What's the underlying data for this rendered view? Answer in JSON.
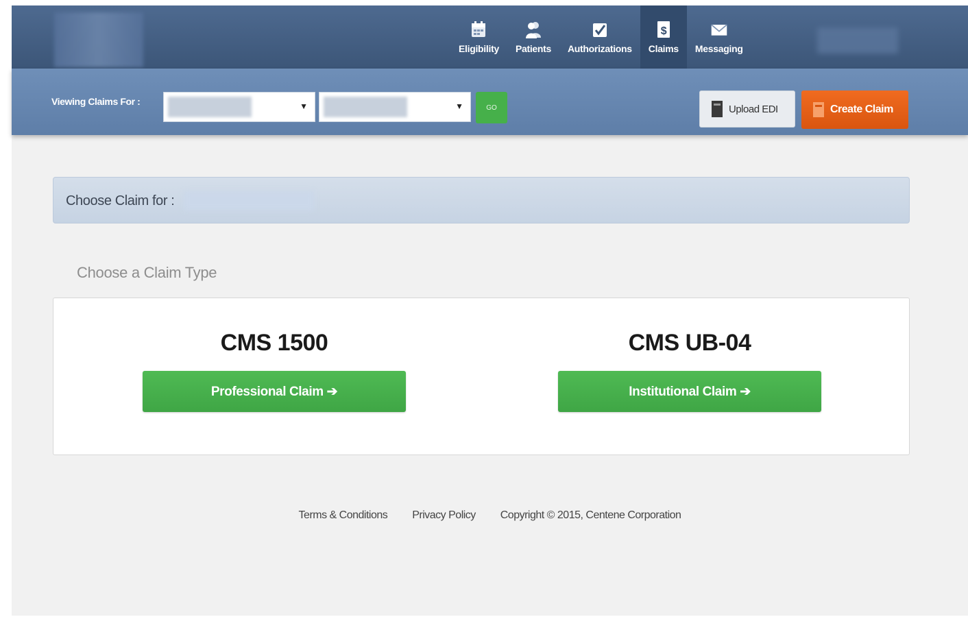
{
  "nav": {
    "items": [
      {
        "label": "Eligibility",
        "icon": "calendar-icon"
      },
      {
        "label": "Patients",
        "icon": "users-icon"
      },
      {
        "label": "Authorizations",
        "icon": "checkbox-icon"
      },
      {
        "label": "Claims",
        "icon": "dollar-document-icon",
        "active": true
      },
      {
        "label": "Messaging",
        "icon": "envelope-icon"
      }
    ]
  },
  "toolbar": {
    "viewing_label": "Viewing Claims For :",
    "go_label": "GO",
    "upload_label": "Upload EDI",
    "create_label": "Create Claim"
  },
  "choose_panel": {
    "label": "Choose Claim for :"
  },
  "claim_type": {
    "heading": "Choose a Claim Type",
    "options": [
      {
        "title": "CMS 1500",
        "button": "Professional Claim ➔"
      },
      {
        "title": "CMS UB-04",
        "button": "Institutional Claim ➔"
      }
    ]
  },
  "footer": {
    "terms": "Terms & Conditions",
    "privacy": "Privacy Policy",
    "copyright": "Copyright © 2015, Centene Corporation"
  },
  "colors": {
    "topbar": "#44608a",
    "subbar": "#6888b2",
    "go": "#46b04a",
    "create": "#e8601a",
    "claim_button": "#46b04a"
  }
}
